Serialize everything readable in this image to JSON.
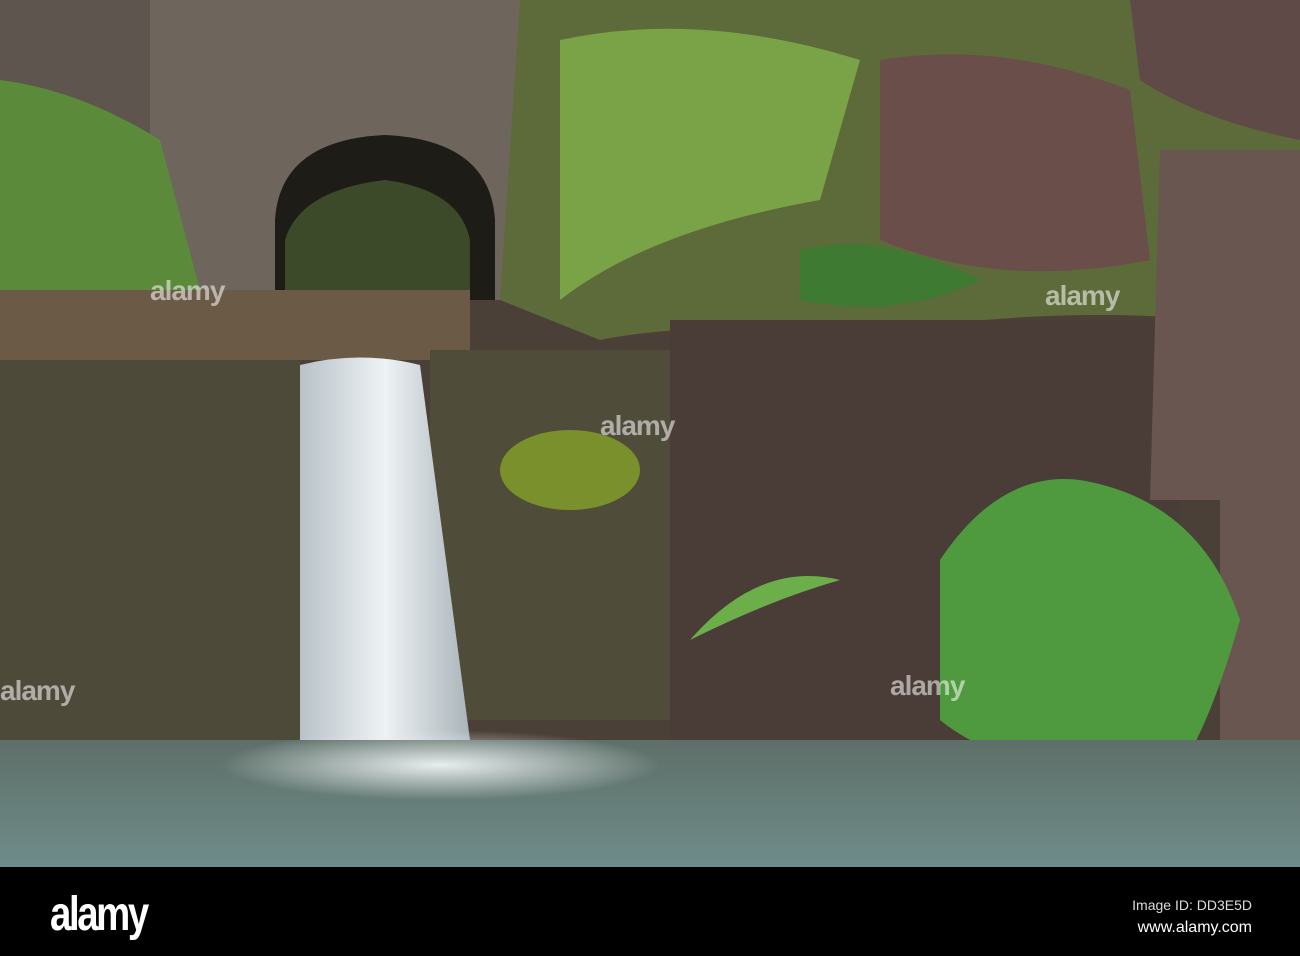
{
  "watermark": "alamy",
  "footer": {
    "logo": "alamy",
    "image_id": "Image ID: DD3E5D",
    "site": "www.alamy.com"
  },
  "colors": {
    "stone": "#6b5e52",
    "moss": "#6f8a2e",
    "fern": "#4e8a34",
    "water": "#7e9a96",
    "bar": "#000000"
  }
}
